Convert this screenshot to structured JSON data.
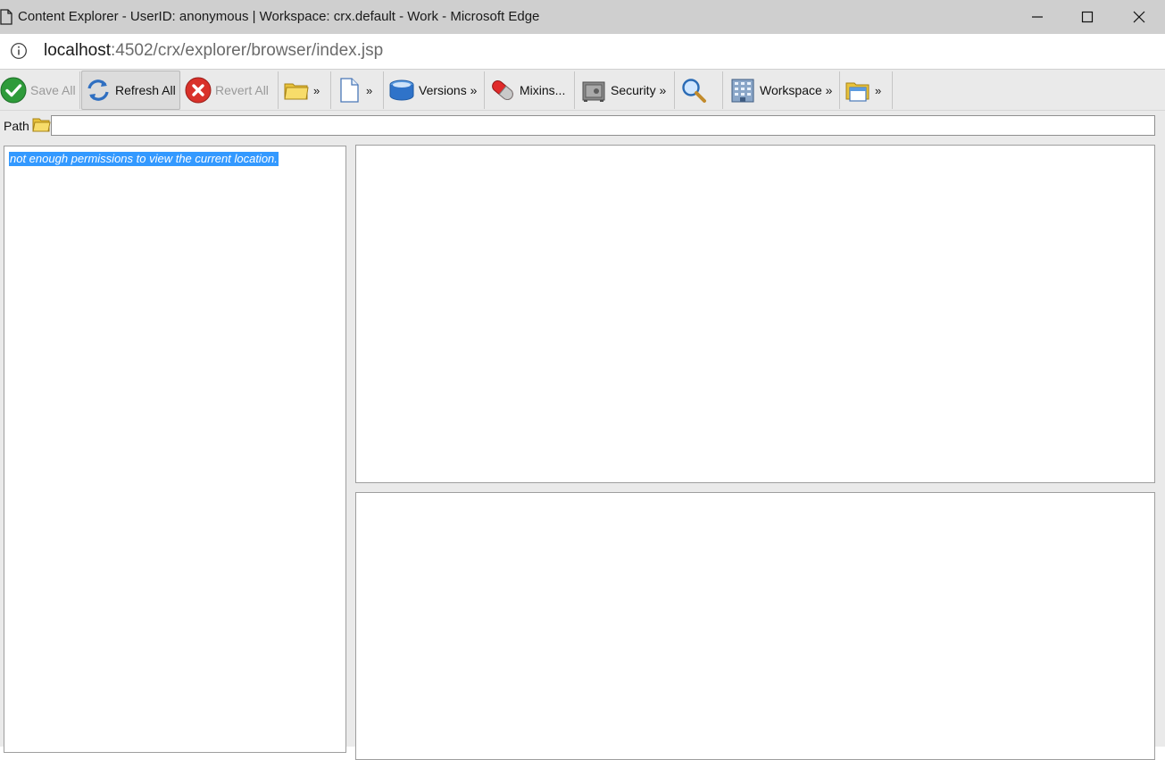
{
  "window": {
    "title": "Content Explorer - UserID: anonymous | Workspace: crx.default - Work - Microsoft Edge",
    "icon": "page-icon",
    "controls": [
      "minimize-icon",
      "maximize-icon",
      "close-icon"
    ]
  },
  "address": {
    "host": "localhost",
    "rest": ":4502/crx/explorer/browser/index.jsp",
    "icon": "info-icon"
  },
  "toolbar": {
    "save_all": "Save All",
    "refresh_all": "Refresh All",
    "revert_all": "Revert All",
    "new_node_chevron": "»",
    "new_file_chevron": "»",
    "versions": "Versions »",
    "mixins": "Mixins...",
    "security": "Security »",
    "workspace": "Workspace »",
    "clipboard_chevron": "»"
  },
  "path": {
    "label": "Path",
    "value": ""
  },
  "tree": {
    "message": "not enough permissions to view the current location."
  },
  "colors": {
    "selection": "#3399ff",
    "toolbar_bg": "#eaeaea",
    "titlebar_bg": "#cfcfcf"
  }
}
